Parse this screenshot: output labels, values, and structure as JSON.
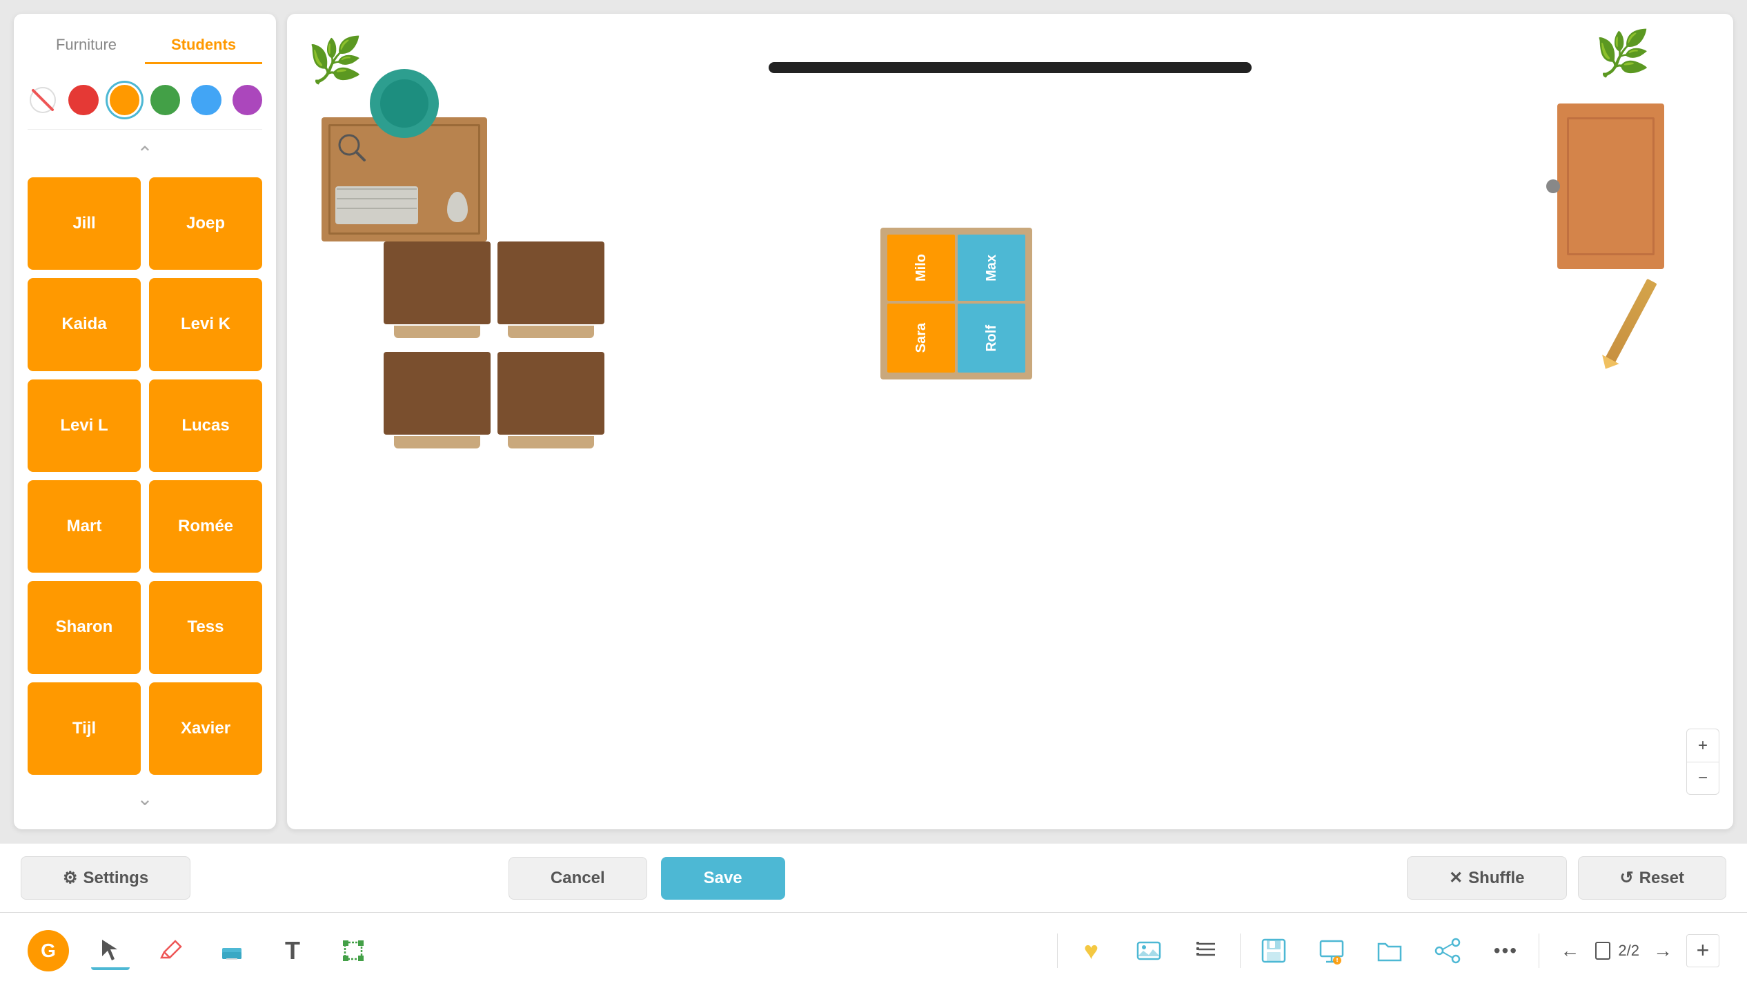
{
  "tabs": {
    "furniture": "Furniture",
    "students": "Students"
  },
  "colors": [
    {
      "name": "eraser",
      "symbol": "⌀"
    },
    {
      "name": "red",
      "hex": "#e53935"
    },
    {
      "name": "orange",
      "hex": "#f90",
      "active": true
    },
    {
      "name": "green",
      "hex": "#43a047"
    },
    {
      "name": "blue",
      "hex": "#42a5f5"
    },
    {
      "name": "purple",
      "hex": "#ab47bc"
    }
  ],
  "students": [
    "Jill",
    "Joep",
    "Kaida",
    "Levi K",
    "Levi L",
    "Lucas",
    "Mart",
    "Romée",
    "Sharon",
    "Tess",
    "Tijl",
    "Xavier"
  ],
  "classroom": {
    "group_desk_students": [
      {
        "name": "Milo",
        "color": "orange"
      },
      {
        "name": "Max",
        "color": "blue"
      },
      {
        "name": "Sara",
        "color": "orange"
      },
      {
        "name": "Rolf",
        "color": "blue"
      }
    ]
  },
  "actions": {
    "settings": "Settings",
    "cancel": "Cancel",
    "save": "Save",
    "shuffle": "Shuffle",
    "reset": "Reset"
  },
  "pagination": {
    "current": "2",
    "total": "2",
    "display": "2/2"
  },
  "toolbar": {
    "logo": "G"
  }
}
